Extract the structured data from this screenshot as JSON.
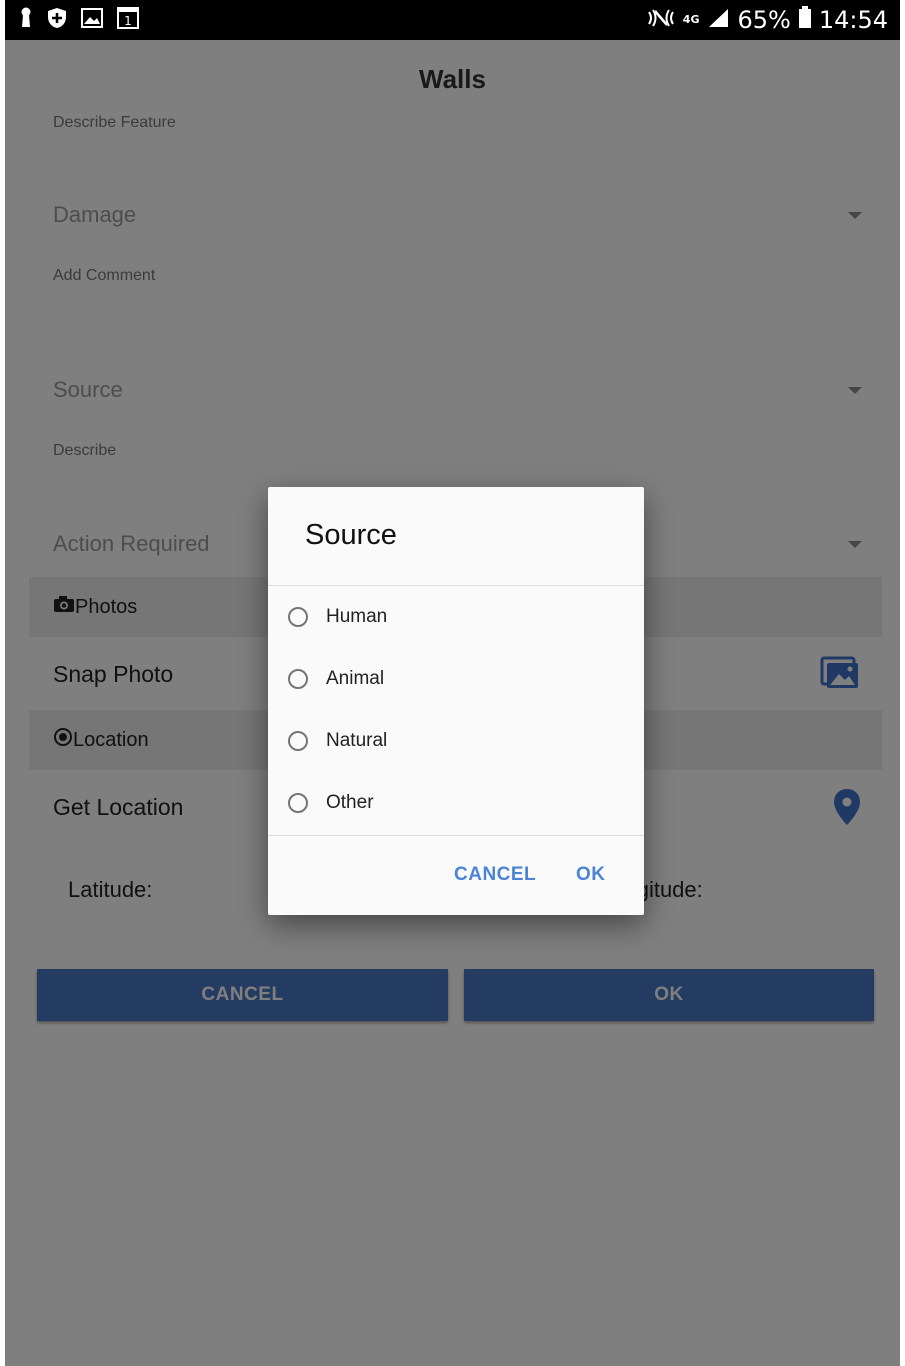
{
  "statusbar": {
    "battery": "65%",
    "time": "14:54",
    "network": "4G",
    "left_icons": [
      "keyhole-icon",
      "shield-icon",
      "gallery-icon",
      "calendar-icon"
    ],
    "calendar_day": "1"
  },
  "page": {
    "title": "Walls",
    "describe_feature_label": "Describe Feature",
    "damage_placeholder": "Damage",
    "add_comment_label": "Add Comment",
    "source_placeholder": "Source",
    "describe_label": "Describe",
    "action_required_placeholder": "Action Required",
    "photos_section": "Photos",
    "snap_photo": "Snap Photo",
    "location_section": "Location",
    "get_location": "Get Location",
    "latitude_label": "Latitude:",
    "longitude_label": "Longitude:",
    "cancel_button": "CANCEL",
    "ok_button": "OK"
  },
  "dialog": {
    "title": "Source",
    "options": [
      "Human",
      "Animal",
      "Natural",
      "Other"
    ],
    "cancel": "CANCEL",
    "ok": "OK"
  },
  "colors": {
    "primary": "#4b78c4",
    "dialog_button": "#4b84d6",
    "scrim": "rgba(0,0,0,0.5)"
  }
}
